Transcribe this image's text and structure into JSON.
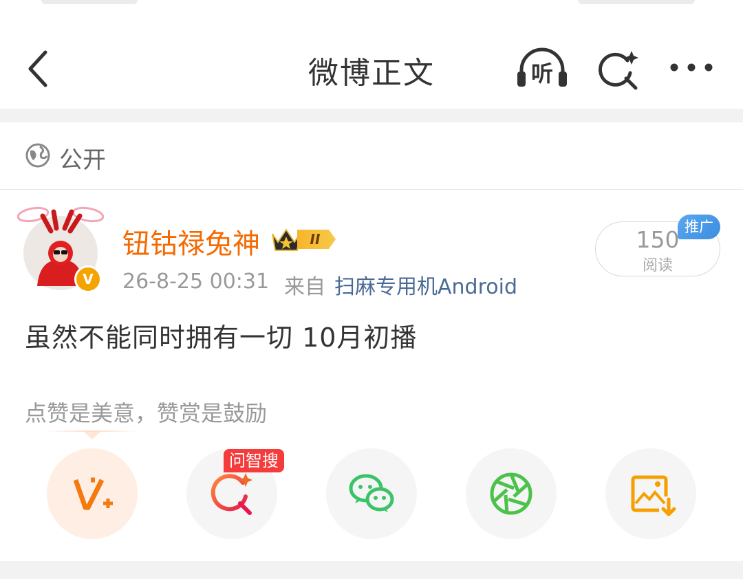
{
  "nav": {
    "title": "微博正文",
    "listen_label": "听"
  },
  "visibility": {
    "label": "公开"
  },
  "author": {
    "name": "钮钴禄兔神",
    "level_badge": "II",
    "verified_badge": "V"
  },
  "meta": {
    "time": "26-8-25 00:31",
    "from_label": "来自",
    "source": "扫麻专用机Android"
  },
  "read": {
    "count": "150",
    "label": "阅读",
    "promo": "推广"
  },
  "post": {
    "text": "虽然不能同时拥有一切 10月初播"
  },
  "reward": {
    "hint": "点赞是美意，赞赏是鼓励"
  },
  "share": {
    "zhisou_badge": "问智搜",
    "items": [
      "v-plus-icon",
      "zhisou-icon",
      "wechat-icon",
      "moments-icon",
      "save-image-icon"
    ]
  },
  "colors": {
    "accent_orange": "#f56a00",
    "source_blue": "#4a6a96",
    "wechat_green": "#3cc36a",
    "save_orange": "#f5a000",
    "zhisou_red": "#f53b3b"
  }
}
